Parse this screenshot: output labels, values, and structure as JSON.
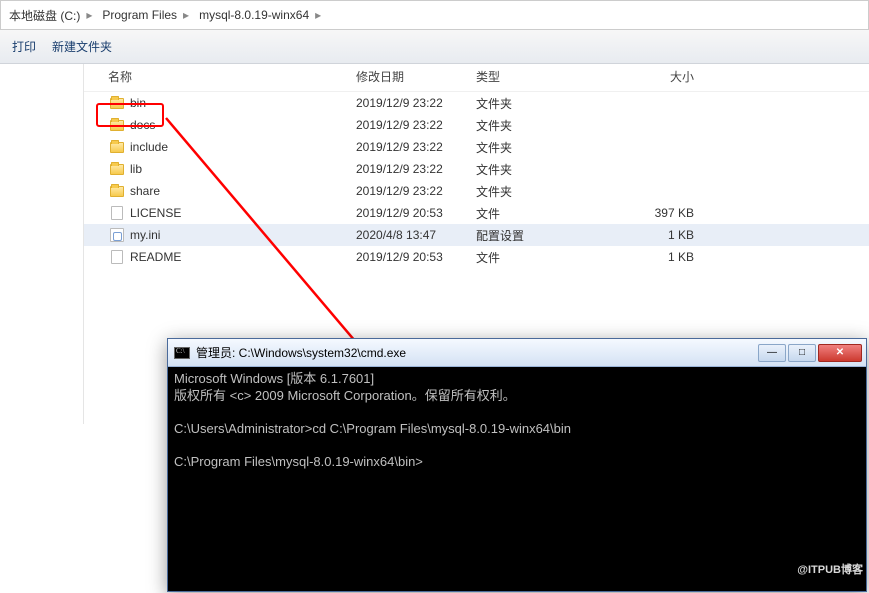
{
  "breadcrumb": {
    "drive": "本地磁盘 (C:)",
    "seg1": "Program Files",
    "seg2": "mysql-8.0.19-winx64"
  },
  "toolbar": {
    "print": "打印",
    "newfolder": "新建文件夹"
  },
  "columns": {
    "name": "名称",
    "date": "修改日期",
    "type": "类型",
    "size": "大小"
  },
  "files": [
    {
      "name": "bin",
      "date": "2019/12/9 23:22",
      "type": "文件夹",
      "size": "",
      "icon": "folder"
    },
    {
      "name": "docs",
      "date": "2019/12/9 23:22",
      "type": "文件夹",
      "size": "",
      "icon": "folder"
    },
    {
      "name": "include",
      "date": "2019/12/9 23:22",
      "type": "文件夹",
      "size": "",
      "icon": "folder"
    },
    {
      "name": "lib",
      "date": "2019/12/9 23:22",
      "type": "文件夹",
      "size": "",
      "icon": "folder"
    },
    {
      "name": "share",
      "date": "2019/12/9 23:22",
      "type": "文件夹",
      "size": "",
      "icon": "folder"
    },
    {
      "name": "LICENSE",
      "date": "2019/12/9 20:53",
      "type": "文件",
      "size": "397 KB",
      "icon": "file"
    },
    {
      "name": "my.ini",
      "date": "2020/4/8 13:47",
      "type": "配置设置",
      "size": "1 KB",
      "icon": "ini",
      "selected": true
    },
    {
      "name": "README",
      "date": "2019/12/9 20:53",
      "type": "文件",
      "size": "1 KB",
      "icon": "file"
    }
  ],
  "cmd": {
    "title": "管理员: C:\\Windows\\system32\\cmd.exe",
    "line1": "Microsoft Windows [版本 6.1.7601]",
    "line2": "版权所有 <c> 2009 Microsoft Corporation。保留所有权利。",
    "line3": "C:\\Users\\Administrator>cd C:\\Program Files\\mysql-8.0.19-winx64\\bin",
    "line4": "C:\\Program Files\\mysql-8.0.19-winx64\\bin>"
  },
  "watermark": "@ITPUB博客"
}
